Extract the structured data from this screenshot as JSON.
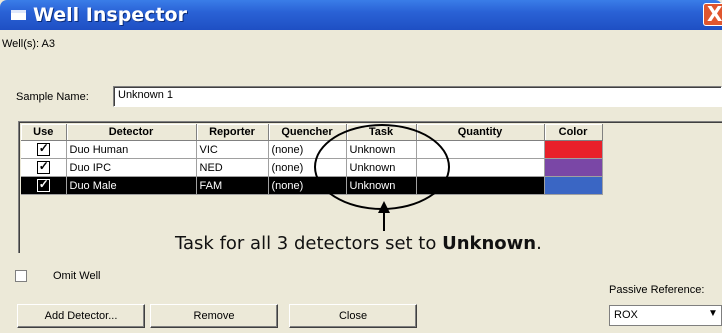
{
  "window": {
    "title": "Well Inspector",
    "close_glyph": "X"
  },
  "wells": {
    "label": "Well(s):",
    "value": "A3"
  },
  "sample": {
    "label": "Sample Name:",
    "value": "Unknown 1"
  },
  "table": {
    "headers": [
      "Use",
      "Detector",
      "Reporter",
      "Quencher",
      "Task",
      "Quantity",
      "Color"
    ],
    "rows": [
      {
        "use": true,
        "detector": "Duo Human",
        "reporter": "VIC",
        "quencher": "(none)",
        "task": "Unknown",
        "quantity": "",
        "color": "#e8202a"
      },
      {
        "use": true,
        "detector": "Duo IPC",
        "reporter": "NED",
        "quencher": "(none)",
        "task": "Unknown",
        "quantity": "",
        "color": "#7a47a6"
      },
      {
        "use": true,
        "detector": "Duo Male",
        "reporter": "FAM",
        "quencher": "(none)",
        "task": "Unknown",
        "quantity": "",
        "color": "#3a66c4"
      }
    ],
    "selected_row": 2
  },
  "annotation": {
    "text_before": "Task for all 3 detectors set to ",
    "text_bold": "Unknown",
    "text_after": "."
  },
  "omit_well": {
    "label": "Omit Well",
    "checked": false
  },
  "buttons": {
    "add_detector": "Add Detector...",
    "remove": "Remove",
    "close": "Close"
  },
  "passive_reference": {
    "label": "Passive Reference:",
    "value": "ROX"
  }
}
